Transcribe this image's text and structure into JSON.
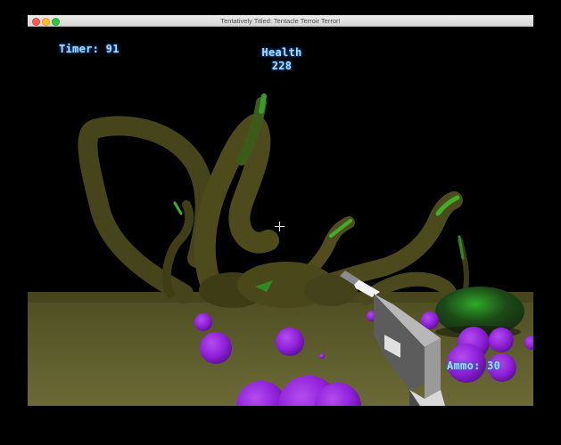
{
  "window": {
    "title": "Tentatively Titled: Tentacle Terroir Terror!"
  },
  "hud": {
    "timer_text": "Timer: 91",
    "health_label": "Health",
    "health_value": "228",
    "ammo_text": "Ammo: 30"
  },
  "colors": {
    "hud_text": "#a9d8ff",
    "hud_glow": "#2e7bd6",
    "tentacle": "#4b4818",
    "tentacle_tip": "#3fae2a",
    "ground": "#5b5a2a",
    "egg": "#8a1fd6",
    "gun_body": "#8d8d8d",
    "gun_top": "#d8d8d8"
  },
  "icons": {
    "crosshair": "crosshair-icon"
  }
}
